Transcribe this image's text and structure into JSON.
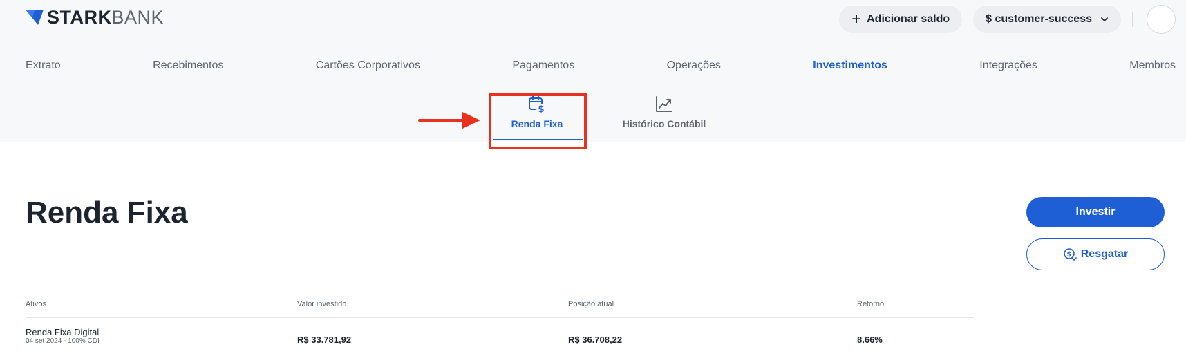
{
  "brand": {
    "name_bold": "STARK",
    "name_light": "BANK"
  },
  "top_bar": {
    "add_balance_label": "Adicionar saldo",
    "workspace_label": "$ customer-success"
  },
  "nav": {
    "items": [
      {
        "label": "Extrato"
      },
      {
        "label": "Recebimentos"
      },
      {
        "label": "Cartões Corporativos"
      },
      {
        "label": "Pagamentos"
      },
      {
        "label": "Operações"
      },
      {
        "label": "Investimentos",
        "active": true
      },
      {
        "label": "Integrações"
      },
      {
        "label": "Membros"
      }
    ]
  },
  "subtabs": [
    {
      "label": "Renda Fixa",
      "active": true,
      "icon": "calendar-dollar-icon"
    },
    {
      "label": "Histórico Contábil",
      "active": false,
      "icon": "chart-line-icon"
    }
  ],
  "page": {
    "title": "Renda Fixa",
    "invest_label": "Investir",
    "redeem_label": "Resgatar"
  },
  "table": {
    "headers": {
      "asset": "Ativos",
      "invested": "Valor investido",
      "position": "Posição atual",
      "return": "Retorno"
    },
    "rows": [
      {
        "asset": "Renda Fixa Digital",
        "asset_sub": "04 set 2024 - 100% CDI",
        "invested": "R$ 33.781,92",
        "position": "R$ 36.708,22",
        "return": "8.66%"
      }
    ]
  },
  "colors": {
    "accent": "#1f5fd6",
    "annotation": "#e8321f",
    "header_bg": "#f7f8fa",
    "text": "#1c2430"
  }
}
